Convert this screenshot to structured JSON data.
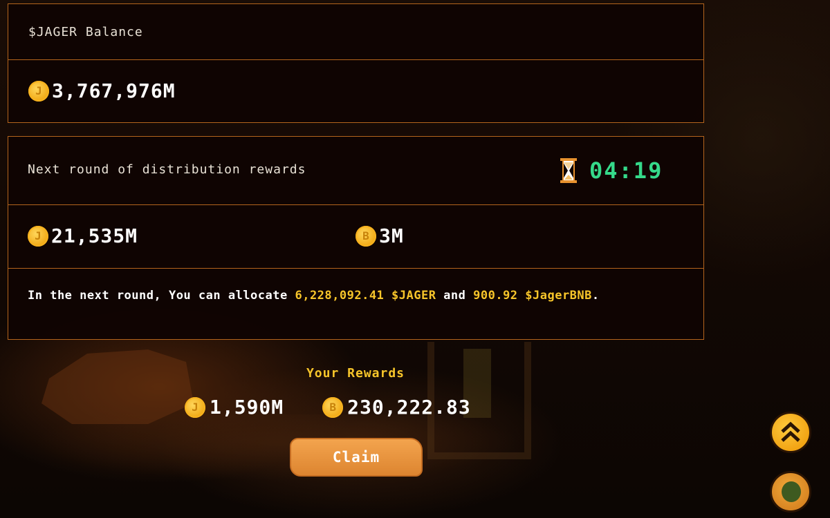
{
  "balance": {
    "title": "$JAGER Balance",
    "amount": "3,767,976M",
    "coin_icon": "jager-coin-icon"
  },
  "distribution": {
    "title": "Next round of distribution rewards",
    "timer": "04:19",
    "timer_color": "#35d98a",
    "jager_pool": "21,535M",
    "bnb_pool": "3M",
    "info": {
      "prefix": "In the next round, You can allocate ",
      "jager_amount": "6,228,092.41 $JAGER",
      "middle": " and ",
      "bnb_amount": "900.92 $JagerBNB",
      "suffix": "."
    }
  },
  "rewards": {
    "title": "Your Rewards",
    "jager": "1,590M",
    "bnb": "230,222.83",
    "claim_label": "Claim"
  },
  "colors": {
    "accent_yellow": "#f7c52a",
    "panel_border": "#b5651d",
    "button_orange": "#e8923d"
  }
}
